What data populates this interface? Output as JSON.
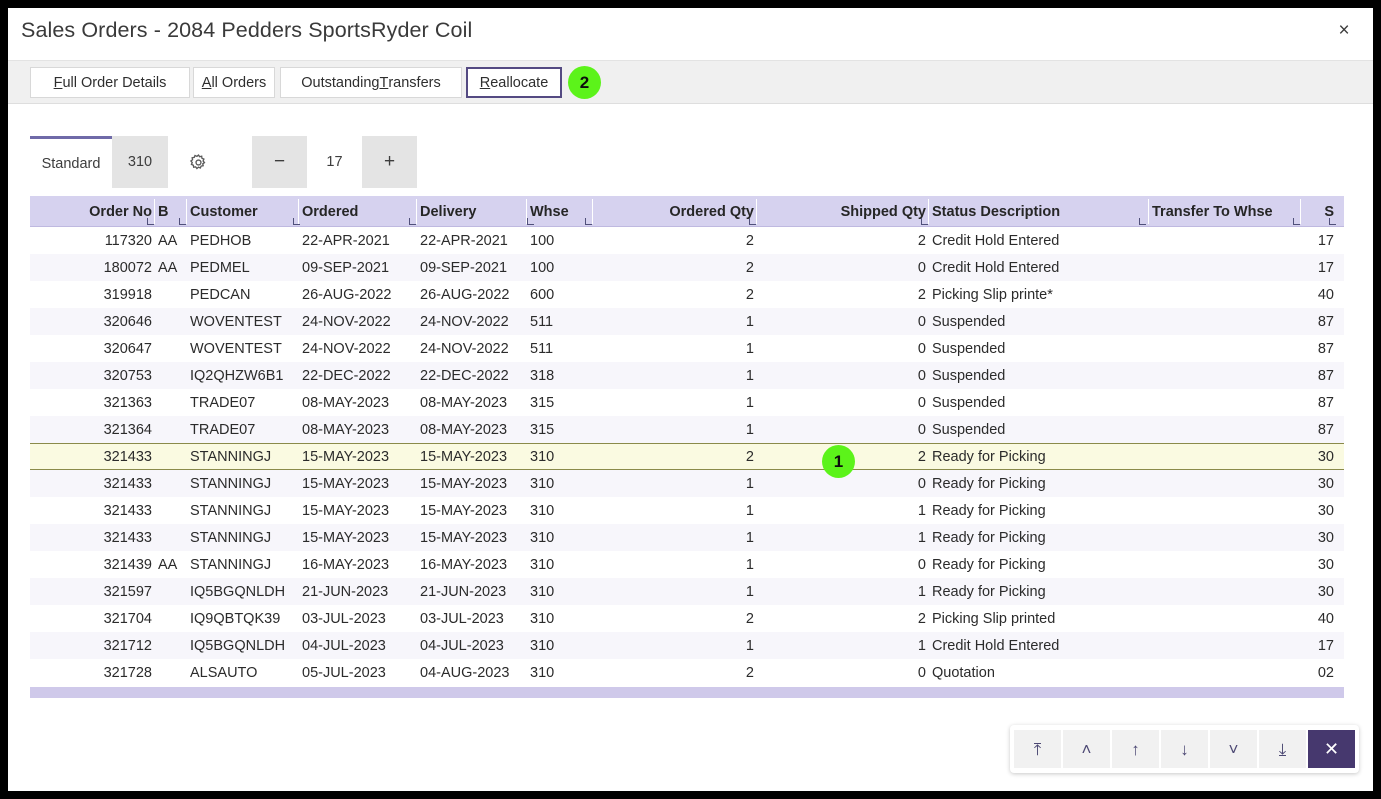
{
  "window": {
    "title": "Sales Orders - 2084 Pedders SportsRyder Coil",
    "close_icon": "close-icon",
    "close_glyph": "×"
  },
  "tabs": [
    {
      "label": "Full Order Details",
      "accel": "F",
      "rest": "ull Order Details",
      "focused": false
    },
    {
      "label": "All Orders",
      "accel": "A",
      "rest": "ll Orders",
      "focused": false
    },
    {
      "label": "Outstanding Transfers",
      "pre": "Outstanding ",
      "accel": "T",
      "rest": "ransfers",
      "focused": false
    },
    {
      "label": "Reallocate",
      "accel": "R",
      "rest": "eallocate",
      "focused": true
    }
  ],
  "callouts": [
    {
      "number": "2",
      "target": "reallocate-tab"
    },
    {
      "number": "1",
      "target": "selected-row"
    }
  ],
  "toolbar": {
    "view_label": "Standard",
    "warehouse_label": "310",
    "settings_icon": "gear-icon",
    "decrement_label": "−",
    "rows_value": "17",
    "increment_label": "+"
  },
  "grid": {
    "columns": [
      {
        "key": "order_no",
        "label": "Order No",
        "align": "right"
      },
      {
        "key": "b",
        "label": "B",
        "align": "left"
      },
      {
        "key": "customer",
        "label": "Customer",
        "align": "left"
      },
      {
        "key": "ordered",
        "label": "Ordered",
        "align": "left"
      },
      {
        "key": "delivery",
        "label": "Delivery",
        "align": "left"
      },
      {
        "key": "whse",
        "label": "Whse",
        "align": "left"
      },
      {
        "key": "ordered_qty",
        "label": "Ordered Qty",
        "align": "right"
      },
      {
        "key": "shipped_qty",
        "label": "Shipped Qty",
        "align": "right"
      },
      {
        "key": "status",
        "label": "Status Description",
        "align": "left"
      },
      {
        "key": "transfer_to",
        "label": "Transfer To Whse",
        "align": "left"
      },
      {
        "key": "s",
        "label": "S",
        "align": "right"
      }
    ],
    "rows": [
      {
        "order_no": "117320",
        "b": "AA",
        "customer": "PEDHOB",
        "ordered": "22-APR-2021",
        "delivery": "22-APR-2021",
        "whse": "100",
        "ordered_qty": "2",
        "shipped_qty": "2",
        "status": "Credit Hold Entered",
        "transfer_to": "",
        "s": "17",
        "selected": false
      },
      {
        "order_no": "180072",
        "b": "AA",
        "customer": "PEDMEL",
        "ordered": "09-SEP-2021",
        "delivery": "09-SEP-2021",
        "whse": "100",
        "ordered_qty": "2",
        "shipped_qty": "0",
        "status": "Credit Hold Entered",
        "transfer_to": "",
        "s": "17",
        "selected": false
      },
      {
        "order_no": "319918",
        "b": "",
        "customer": "PEDCAN",
        "ordered": "26-AUG-2022",
        "delivery": "26-AUG-2022",
        "whse": "600",
        "ordered_qty": "2",
        "shipped_qty": "2",
        "status": "Picking Slip printe*",
        "transfer_to": "",
        "s": "40",
        "selected": false
      },
      {
        "order_no": "320646",
        "b": "",
        "customer": "WOVENTEST",
        "ordered": "24-NOV-2022",
        "delivery": "24-NOV-2022",
        "whse": "511",
        "ordered_qty": "1",
        "shipped_qty": "0",
        "status": "Suspended",
        "transfer_to": "",
        "s": "87",
        "selected": false
      },
      {
        "order_no": "320647",
        "b": "",
        "customer": "WOVENTEST",
        "ordered": "24-NOV-2022",
        "delivery": "24-NOV-2022",
        "whse": "511",
        "ordered_qty": "1",
        "shipped_qty": "0",
        "status": "Suspended",
        "transfer_to": "",
        "s": "87",
        "selected": false
      },
      {
        "order_no": "320753",
        "b": "",
        "customer": "IQ2QHZW6B1",
        "ordered": "22-DEC-2022",
        "delivery": "22-DEC-2022",
        "whse": "318",
        "ordered_qty": "1",
        "shipped_qty": "0",
        "status": "Suspended",
        "transfer_to": "",
        "s": "87",
        "selected": false
      },
      {
        "order_no": "321363",
        "b": "",
        "customer": "TRADE07",
        "ordered": "08-MAY-2023",
        "delivery": "08-MAY-2023",
        "whse": "315",
        "ordered_qty": "1",
        "shipped_qty": "0",
        "status": "Suspended",
        "transfer_to": "",
        "s": "87",
        "selected": false
      },
      {
        "order_no": "321364",
        "b": "",
        "customer": "TRADE07",
        "ordered": "08-MAY-2023",
        "delivery": "08-MAY-2023",
        "whse": "315",
        "ordered_qty": "1",
        "shipped_qty": "0",
        "status": "Suspended",
        "transfer_to": "",
        "s": "87",
        "selected": false
      },
      {
        "order_no": "321433",
        "b": "",
        "customer": "STANNINGJ",
        "ordered": "15-MAY-2023",
        "delivery": "15-MAY-2023",
        "whse": "310",
        "ordered_qty": "2",
        "shipped_qty": "2",
        "status": "Ready for Picking",
        "transfer_to": "",
        "s": "30",
        "selected": true
      },
      {
        "order_no": "321433",
        "b": "",
        "customer": "STANNINGJ",
        "ordered": "15-MAY-2023",
        "delivery": "15-MAY-2023",
        "whse": "310",
        "ordered_qty": "1",
        "shipped_qty": "0",
        "status": "Ready for Picking",
        "transfer_to": "",
        "s": "30",
        "selected": false
      },
      {
        "order_no": "321433",
        "b": "",
        "customer": "STANNINGJ",
        "ordered": "15-MAY-2023",
        "delivery": "15-MAY-2023",
        "whse": "310",
        "ordered_qty": "1",
        "shipped_qty": "1",
        "status": "Ready for Picking",
        "transfer_to": "",
        "s": "30",
        "selected": false
      },
      {
        "order_no": "321433",
        "b": "",
        "customer": "STANNINGJ",
        "ordered": "15-MAY-2023",
        "delivery": "15-MAY-2023",
        "whse": "310",
        "ordered_qty": "1",
        "shipped_qty": "1",
        "status": "Ready for Picking",
        "transfer_to": "",
        "s": "30",
        "selected": false
      },
      {
        "order_no": "321439",
        "b": "AA",
        "customer": "STANNINGJ",
        "ordered": "16-MAY-2023",
        "delivery": "16-MAY-2023",
        "whse": "310",
        "ordered_qty": "1",
        "shipped_qty": "0",
        "status": "Ready for Picking",
        "transfer_to": "",
        "s": "30",
        "selected": false
      },
      {
        "order_no": "321597",
        "b": "",
        "customer": "IQ5BGQNLDH",
        "ordered": "21-JUN-2023",
        "delivery": "21-JUN-2023",
        "whse": "310",
        "ordered_qty": "1",
        "shipped_qty": "1",
        "status": "Ready for Picking",
        "transfer_to": "",
        "s": "30",
        "selected": false
      },
      {
        "order_no": "321704",
        "b": "",
        "customer": "IQ9QBTQK39",
        "ordered": "03-JUL-2023",
        "delivery": "03-JUL-2023",
        "whse": "310",
        "ordered_qty": "2",
        "shipped_qty": "2",
        "status": "Picking Slip printed",
        "transfer_to": "",
        "s": "40",
        "selected": false
      },
      {
        "order_no": "321712",
        "b": "",
        "customer": "IQ5BGQNLDH",
        "ordered": "04-JUL-2023",
        "delivery": "04-JUL-2023",
        "whse": "310",
        "ordered_qty": "1",
        "shipped_qty": "1",
        "status": "Credit Hold Entered",
        "transfer_to": "",
        "s": "17",
        "selected": false
      },
      {
        "order_no": "321728",
        "b": "",
        "customer": "ALSAUTO",
        "ordered": "05-JUL-2023",
        "delivery": "04-AUG-2023",
        "whse": "310",
        "ordered_qty": "2",
        "shipped_qty": "0",
        "status": "Quotation",
        "transfer_to": "",
        "s": "02",
        "selected": false
      }
    ]
  },
  "navbar": {
    "buttons": [
      {
        "name": "first-record-button",
        "icon": "first-record-icon",
        "glyph": "⤒"
      },
      {
        "name": "page-up-button",
        "icon": "chevron-up-icon",
        "glyph": "˄"
      },
      {
        "name": "previous-record-button",
        "icon": "arrow-up-icon",
        "glyph": "↑"
      },
      {
        "name": "next-record-button",
        "icon": "arrow-down-icon",
        "glyph": "↓"
      },
      {
        "name": "page-down-button",
        "icon": "chevron-down-icon",
        "glyph": "˅"
      },
      {
        "name": "last-record-button",
        "icon": "last-record-icon",
        "glyph": "⤓"
      },
      {
        "name": "close-panel-button",
        "icon": "close-icon",
        "glyph": "✕",
        "primary": true
      }
    ]
  },
  "colors": {
    "header_bg": "#d6d2ef",
    "accent": "#46386e",
    "callout": "#5cf31a",
    "selected_row": "#fafae1",
    "scrollbar": "#cfc9ea"
  }
}
